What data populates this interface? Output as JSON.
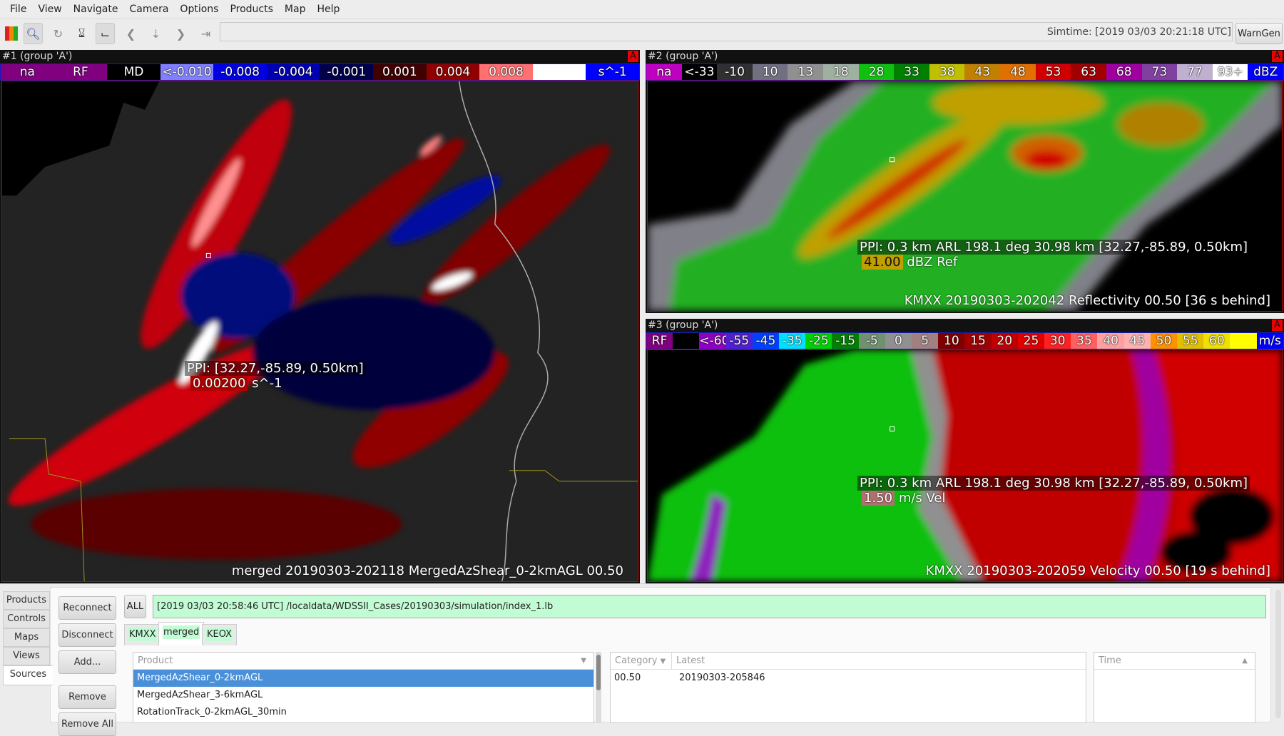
{
  "menu": [
    "File",
    "View",
    "Navigate",
    "Camera",
    "Options",
    "Products",
    "Map",
    "Help"
  ],
  "toolbar": {
    "icons": [
      "colormap-icon",
      "zoom-icon",
      "refresh-icon",
      "hourglass-icon",
      "probe-icon",
      "back-icon",
      "pause-icon",
      "forward-icon",
      "last-icon"
    ],
    "simtime": "Simtime: [2019 03/03 20:21:18 UTC]",
    "warngen": "WarnGen"
  },
  "panels": [
    {
      "title": "#1 (group 'A')",
      "badge": "A",
      "colorbar": [
        {
          "l": "na",
          "c": "#800080"
        },
        {
          "l": "RF",
          "c": "#800080"
        },
        {
          "l": "MD",
          "c": "#000000"
        },
        {
          "l": "<-0.010",
          "c": "#8080ff"
        },
        {
          "l": "-0.008",
          "c": "#0000e0"
        },
        {
          "l": "-0.004",
          "c": "#0000b0"
        },
        {
          "l": "-0.001",
          "c": "#00004a"
        },
        {
          "l": "0.001",
          "c": "#400000"
        },
        {
          "l": "0.004",
          "c": "#900000"
        },
        {
          "l": "0.008",
          "c": "#ff7070"
        },
        {
          "l": "",
          "c": "#ffffff"
        },
        {
          "l": "s^-1",
          "c": "#0000ff"
        }
      ],
      "probe": "PPI: [32.27,-85.89,  0.50km]",
      "value": "0.00200",
      "unit": "s^-1",
      "value_color": "#b00000",
      "footer": "merged 20190303-202118 MergedAzShear_0-2kmAGL 00.50"
    },
    {
      "title": "#2 (group 'A')",
      "badge": "A",
      "colorbar": [
        {
          "l": "na",
          "c": "#c000c0"
        },
        {
          "l": "<-33",
          "c": "#000000"
        },
        {
          "l": "-10",
          "c": "#303030"
        },
        {
          "l": "10",
          "c": "#707080"
        },
        {
          "l": "13",
          "c": "#909090"
        },
        {
          "l": "18",
          "c": "#a0b0a0"
        },
        {
          "l": "28",
          "c": "#10c010"
        },
        {
          "l": "33",
          "c": "#008000"
        },
        {
          "l": "38",
          "c": "#c0c000"
        },
        {
          "l": "43",
          "c": "#c08000"
        },
        {
          "l": "48",
          "c": "#e07000"
        },
        {
          "l": "53",
          "c": "#d00000"
        },
        {
          "l": "63",
          "c": "#a00000"
        },
        {
          "l": "68",
          "c": "#a000a0"
        },
        {
          "l": "73",
          "c": "#8040a0"
        },
        {
          "l": "77",
          "c": "#c0b0d0"
        },
        {
          "l": "93+",
          "c": "#ffffff"
        },
        {
          "l": "dBZ",
          "c": "#0000ff"
        }
      ],
      "probe": "PPI: 0.3 km ARL 198.1 deg 30.98 km [32.27,-85.89,  0.50km]",
      "value": "41.00",
      "unit": "dBZ Ref",
      "value_color": "#c0a000",
      "footer": "KMXX 20190303-202042 Reflectivity 00.50  [36 s behind]"
    },
    {
      "title": "#3 (group 'A')",
      "badge": "A",
      "colorbar": [
        {
          "l": "RF",
          "c": "#800080"
        },
        {
          "l": "",
          "c": "#000000"
        },
        {
          "l": "<-60",
          "c": "#9000c0"
        },
        {
          "l": "-55",
          "c": "#5020d0"
        },
        {
          "l": "-45",
          "c": "#0040ff"
        },
        {
          "l": "-35",
          "c": "#00e0ff"
        },
        {
          "l": "-25",
          "c": "#00d000"
        },
        {
          "l": "-15",
          "c": "#008000"
        },
        {
          "l": "-5",
          "c": "#709070"
        },
        {
          "l": "0",
          "c": "#909090"
        },
        {
          "l": "5",
          "c": "#a08080"
        },
        {
          "l": "10",
          "c": "#800000"
        },
        {
          "l": "15",
          "c": "#a00000"
        },
        {
          "l": "20",
          "c": "#c00000"
        },
        {
          "l": "25",
          "c": "#e00000"
        },
        {
          "l": "30",
          "c": "#ff2020"
        },
        {
          "l": "35",
          "c": "#ff6060"
        },
        {
          "l": "40",
          "c": "#ffa0a0"
        },
        {
          "l": "45",
          "c": "#ffb0b0"
        },
        {
          "l": "50",
          "c": "#ff9000"
        },
        {
          "l": "55",
          "c": "#e0c000"
        },
        {
          "l": "60",
          "c": "#f0e000"
        },
        {
          "l": "",
          "c": "#ffff00"
        },
        {
          "l": "m/s",
          "c": "#0000ff"
        }
      ],
      "probe": "PPI: 0.3 km ARL 198.1 deg 30.98 km [32.27,-85.89,  0.50km]",
      "value": "1.50",
      "unit": "m/s Vel",
      "value_color": "#b07070",
      "footer": "KMXX 20190303-202059 Velocity 00.50  [19 s behind]"
    }
  ],
  "bottom": {
    "side_tabs": [
      "Products",
      "Controls",
      "Maps",
      "Views",
      "Sources"
    ],
    "buttons": [
      "Reconnect",
      "Disconnect",
      "Add...",
      "Remove",
      "Remove All"
    ],
    "all": "ALL",
    "status": "[2019 03/03 20:58:46 UTC] /localdata/WDSSII_Cases/20190303/simulation/index_1.lb",
    "source_tabs": [
      "KMXX",
      "merged",
      "KEOX"
    ],
    "product_header": "Product",
    "products": [
      "MergedAzShear_0-2kmAGL",
      "MergedAzShear_3-6kmAGL",
      "RotationTrack_0-2kmAGL_30min"
    ],
    "category_header": "Category",
    "latest_header": "Latest",
    "rows": [
      {
        "category": "00.50",
        "latest": "20190303-205846"
      }
    ],
    "time_header": "Time"
  }
}
